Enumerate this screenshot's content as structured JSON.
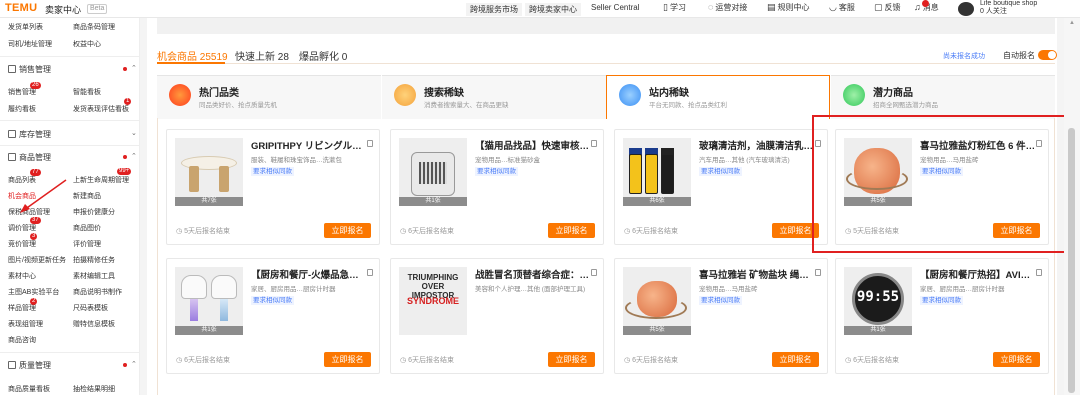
{
  "topbar": {
    "logo": "TEMU",
    "brand": "卖家中心",
    "beta": "Beta",
    "nav": [
      "跨境服务市场",
      "跨境卖家中心",
      "Seller Central"
    ],
    "icons": [
      {
        "icon": "book-icon",
        "label": "学习"
      },
      {
        "icon": "chat-icon",
        "label": "运营对接"
      },
      {
        "icon": "doc-icon",
        "label": "规则中心"
      },
      {
        "icon": "headset-icon",
        "label": "客服"
      },
      {
        "icon": "feedback-icon",
        "label": "反馈"
      },
      {
        "icon": "bell-icon",
        "label": "消息"
      }
    ],
    "shop_name": "Life boutique shop",
    "followers": "0 人关注"
  },
  "sidebar": {
    "top_rows": [
      {
        "left": "发货单列表",
        "right": "商品条码管理"
      },
      {
        "left": "司机/地址管理",
        "right": "权益中心"
      }
    ],
    "sales": {
      "title": "销售管理",
      "rows": [
        {
          "left": "销售管理",
          "right": "智能看板",
          "badge": "26"
        },
        {
          "left": "履约看板",
          "right": "发货表现评估看板",
          "badge": "1"
        }
      ]
    },
    "inventory": {
      "title": "库存管理"
    },
    "goods": {
      "title": "商品管理",
      "rows": [
        {
          "left": "商品列表",
          "right": "上新生命周期管理",
          "badge_left": "77",
          "badge_right": "99+"
        },
        {
          "left": "机会商品",
          "right": "新建商品"
        },
        {
          "left": "保税商品管理",
          "right": "申报价健康分"
        },
        {
          "left": "调价管理",
          "right": "商品图价",
          "badge_left": "37"
        },
        {
          "left": "竞价管理",
          "right": "评价管理",
          "badge_left": "3"
        },
        {
          "left": "图片/视频更新任务",
          "right": "拍摄精修任务"
        },
        {
          "left": "素材中心",
          "right": "素材编辑工具"
        },
        {
          "left": "主图AB实验平台",
          "right": "商品说明书制作"
        },
        {
          "left": "样品管理",
          "right": "尺码表模板",
          "badge_left": "2"
        },
        {
          "left": "表现组管理",
          "right": "赠特信息模板"
        },
        {
          "left": "商品咨询",
          "right": ""
        }
      ]
    },
    "quality": {
      "title": "质量管理",
      "rows": [
        {
          "left": "商品质量看板",
          "right": "抽检结果明细"
        }
      ]
    }
  },
  "tabs": [
    {
      "label": "机会商品 25519",
      "active": true
    },
    {
      "label": "快速上新 28",
      "active": false
    },
    {
      "label": "爆品孵化 0",
      "active": false
    }
  ],
  "right_link": "尚未报名成功",
  "auto_label": "自动报名",
  "categories": [
    {
      "title": "热门品类",
      "sub": "同品类好价、抢点质量先机",
      "icon": "fire-icon",
      "color": "#ff5a2a"
    },
    {
      "title": "搜索稀缺",
      "sub": "消费者搜索量大、在商品更缺",
      "icon": "search-icon",
      "color": "#f4a23b"
    },
    {
      "title": "站内稀缺",
      "sub": "平台无同款、抢点品类红利",
      "icon": "diamond-icon",
      "color": "#3b8ff4"
    },
    {
      "title": "潜力商品",
      "sub": "招商全网甄选潜力商品",
      "icon": "chart-icon",
      "color": "#32c85a"
    }
  ],
  "cards": [
    {
      "title": "GRIPITHPY リビングル…",
      "cat": "服装、鞋履和珠宝饰品…洗漱包",
      "req": "要求相似同款",
      "count": "共7张",
      "deadline": "5天后报名结束",
      "btn": "立即报名",
      "img": "table"
    },
    {
      "title": "【猫用品找品】快速审核…",
      "cat": "宠物用品…标准猫砂盒",
      "req": "要求相似同款",
      "count": "共1张",
      "deadline": "6天后报名结束",
      "btn": "立即报名",
      "img": "air"
    },
    {
      "title": "玻璃清洁剂，油膜清洁乳…",
      "cat": "汽车用品…其他 (汽车玻璃清洁)",
      "req": "要求相似同款",
      "count": "共6张",
      "deadline": "6天后报名结束",
      "btn": "立即报名",
      "img": "glass"
    },
    {
      "title": "喜马拉雅盐灯粉红色 6 件…",
      "cat": "宠物用品…马用盐砖",
      "req": "要求相似同款",
      "count": "共5张",
      "deadline": "5天后报名结束",
      "btn": "立即报名",
      "img": "salt"
    },
    {
      "title": "【厨房和餐厅-火爆品急…",
      "cat": "家居、厨房用品…厨房计时器",
      "req": "要求相似同款",
      "count": "共1张",
      "deadline": "6天后报名结束",
      "btn": "立即报名",
      "img": "tooth"
    },
    {
      "title": "战胜冒名顶替者综合症：…",
      "cat": "美容和个人护理…其他 (面部护理工具)",
      "req": "",
      "count": "",
      "deadline": "6天后报名结束",
      "btn": "立即报名",
      "img": "book"
    },
    {
      "title": "喜马拉雅岩 矿物盐块 绳…",
      "cat": "宠物用品…马用盐砖",
      "req": "要求相似同款",
      "count": "共5张",
      "deadline": "6天后报名结束",
      "btn": "立即报名",
      "img": "salt"
    },
    {
      "title": "【厨房和餐厅热招】AVI…",
      "cat": "家居、厨房用品…厨房计时器",
      "req": "要求相似同款",
      "count": "共1张",
      "deadline": "6天后报名结束",
      "btn": "立即报名",
      "img": "timer"
    }
  ],
  "book_text": {
    "line1": "TRIUMPHING OVER IMPOSTOR",
    "line2": "SYNDROME"
  },
  "timer_text": "99:55",
  "accent": "#fb7701"
}
